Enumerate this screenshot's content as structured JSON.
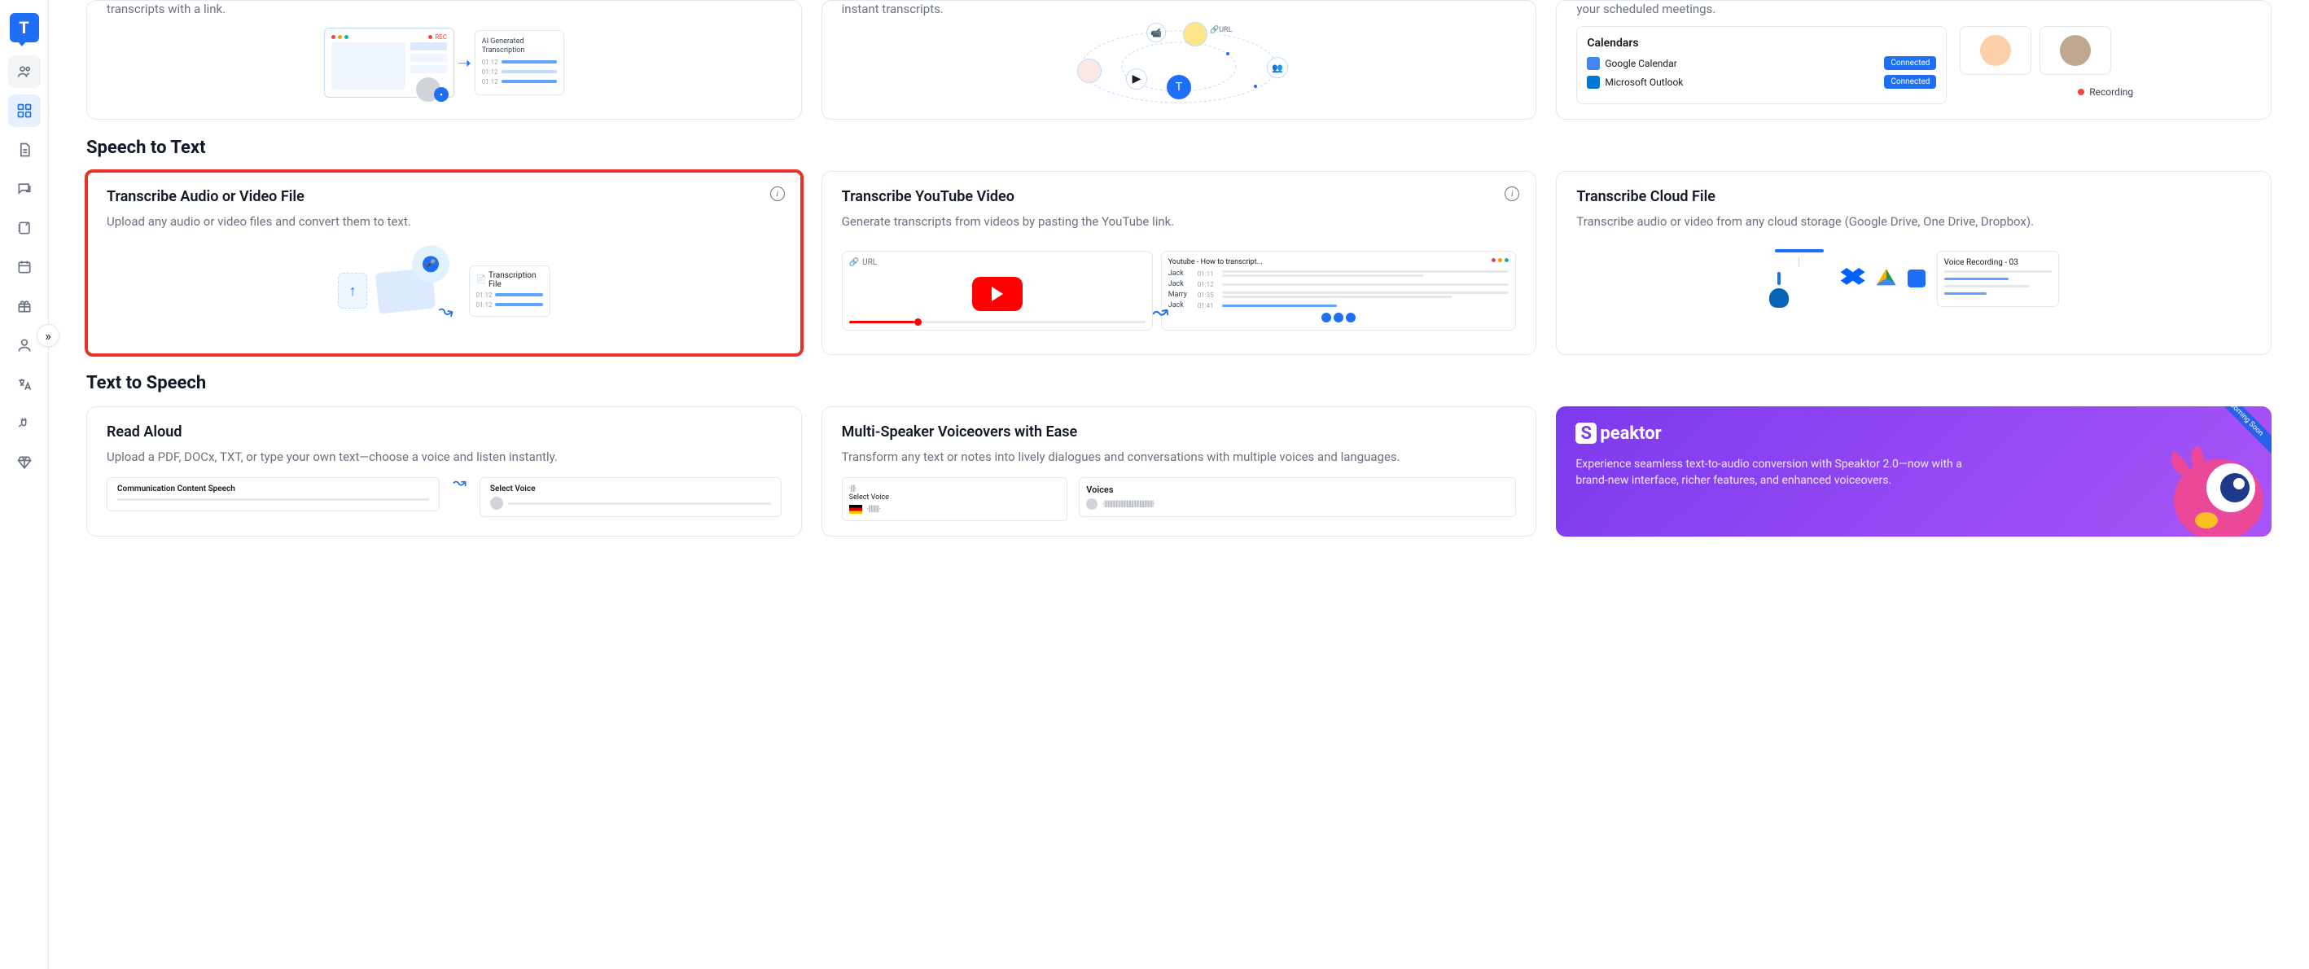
{
  "sidebar": {
    "logo": "T",
    "expand_glyph": "»"
  },
  "row1": {
    "card1_frag": "transcripts with a link.",
    "card2_frag": "instant transcripts.",
    "card3_frag": "your scheduled meetings.",
    "ai_label": "AI Generated Transcription",
    "rec_label": "REC",
    "url_label": "URL",
    "cal_header": "Calendars",
    "cal_google": "Google Calendar",
    "cal_outlook": "Microsoft Outlook",
    "cal_btn": "Connected",
    "recording": "Recording",
    "times": [
      "01:12",
      "01:12",
      "01:12"
    ]
  },
  "section_stt": "Speech to Text",
  "stt": {
    "c1_title": "Transcribe Audio or Video File",
    "c1_desc": "Upload any audio or video files and convert them to text.",
    "c1_tf_label": "Transcription File",
    "c1_times": [
      "01:12",
      "01:12"
    ],
    "c2_title": "Transcribe YouTube Video",
    "c2_desc": "Generate transcripts from videos by pasting the YouTube link.",
    "c2_url": "URL",
    "c2_panel_title": "Youtube - How to transcript...",
    "c2_rows": [
      {
        "name": "Jack",
        "time": "01:11"
      },
      {
        "name": "Jack",
        "time": "01:12"
      },
      {
        "name": "Marry",
        "time": "01:35"
      },
      {
        "name": "Jack",
        "time": "01:41"
      }
    ],
    "c3_title": "Transcribe Cloud File",
    "c3_desc": "Transcribe audio or video from any cloud storage (Google Drive, One Drive, Dropbox).",
    "c3_rec_title": "Voice Recording - 03"
  },
  "section_tts": "Text to Speech",
  "tts": {
    "c1_title": "Read Aloud",
    "c1_desc": "Upload a PDF, DOCx, TXT, or type your own text—choose a voice and listen instantly.",
    "c1_panel1": "Communication Content Speech",
    "c1_panel2": "Select Voice",
    "c2_title": "Multi-Speaker Voiceovers with Ease",
    "c2_desc": "Transform any text or notes into lively dialogues and conversations with multiple voices and languages.",
    "c2_select": "Select Voice",
    "c2_voices": "Voices",
    "speaktor_brand": "peaktor",
    "speaktor_s": "S",
    "speaktor_desc": "Experience seamless text-to-audio conversion with Speaktor 2.0—now with a brand-new interface, richer features, and enhanced voiceovers.",
    "coming_soon": "Coming Soon"
  }
}
